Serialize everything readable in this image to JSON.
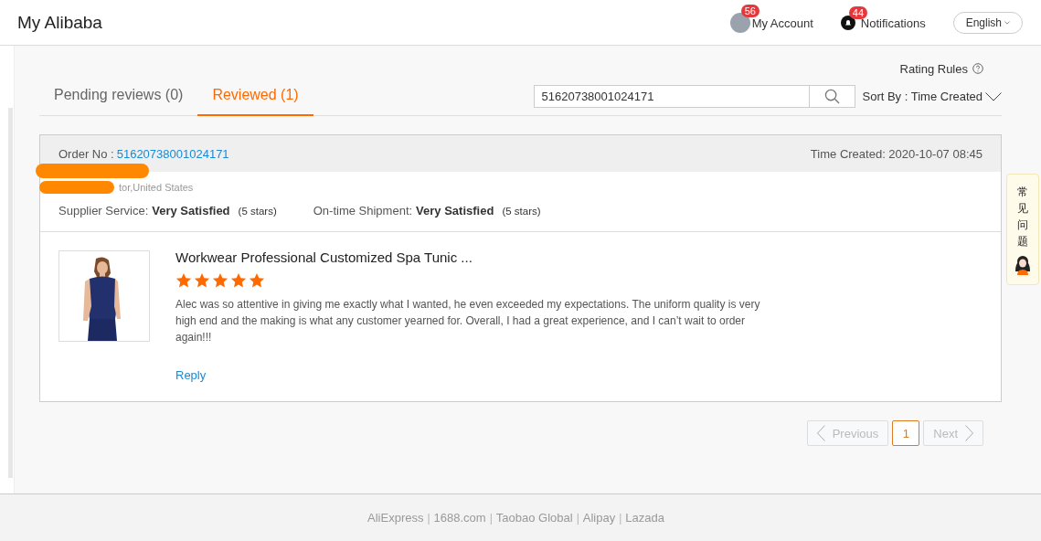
{
  "header": {
    "title": "My Alibaba",
    "account": {
      "label": "My Account",
      "badge": "56"
    },
    "notifications": {
      "label": "Notifications",
      "badge": "44"
    },
    "language": "English"
  },
  "rating_rules": "Rating Rules",
  "tabs": [
    {
      "label": "Pending reviews (0)",
      "selected": false
    },
    {
      "label": "Reviewed (1)",
      "selected": true
    }
  ],
  "search": {
    "value": "51620738001024171"
  },
  "sort": {
    "label": "Sort By : Time Created"
  },
  "order": {
    "label": "Order No :",
    "number": "51620738001024171",
    "time_created": "Time Created: 2020-10-07 08:45",
    "buyer_location": "tor,United States",
    "ratings": [
      {
        "label": "Supplier Service:",
        "value": "Very Satisfied",
        "stars_text": "(5 stars)"
      },
      {
        "label": "On-time Shipment:",
        "value": "Very Satisfied",
        "stars_text": "(5 stars)"
      }
    ],
    "product": {
      "title": "Workwear Professional Customized Spa Tunic ...",
      "stars": 5,
      "review": "Alec was so attentive in giving me exactly what I wanted, he even exceeded my expectations. The uniform quality is very high end and the making is what any customer yearned for. Overall, I had a great experience, and I can’t wait to order again!!!",
      "reply": "Reply"
    }
  },
  "pagination": {
    "previous": {
      "label": "Previous",
      "disabled": true
    },
    "pages": [
      {
        "label": "1",
        "selected": true
      }
    ],
    "next": {
      "label": "Next",
      "disabled": true
    }
  },
  "side_help": "常见问题",
  "footer": [
    {
      "kind": "link",
      "label": "AliExpress"
    },
    {
      "kind": "separator",
      "label": "|"
    },
    {
      "kind": "link",
      "label": "1688.com"
    },
    {
      "kind": "separator",
      "label": "|"
    },
    {
      "kind": "link",
      "label": "Taobao Global"
    },
    {
      "kind": "separator",
      "label": "|"
    },
    {
      "kind": "link",
      "label": "Alipay"
    },
    {
      "kind": "separator",
      "label": "|"
    },
    {
      "kind": "link",
      "label": "Lazada"
    }
  ]
}
